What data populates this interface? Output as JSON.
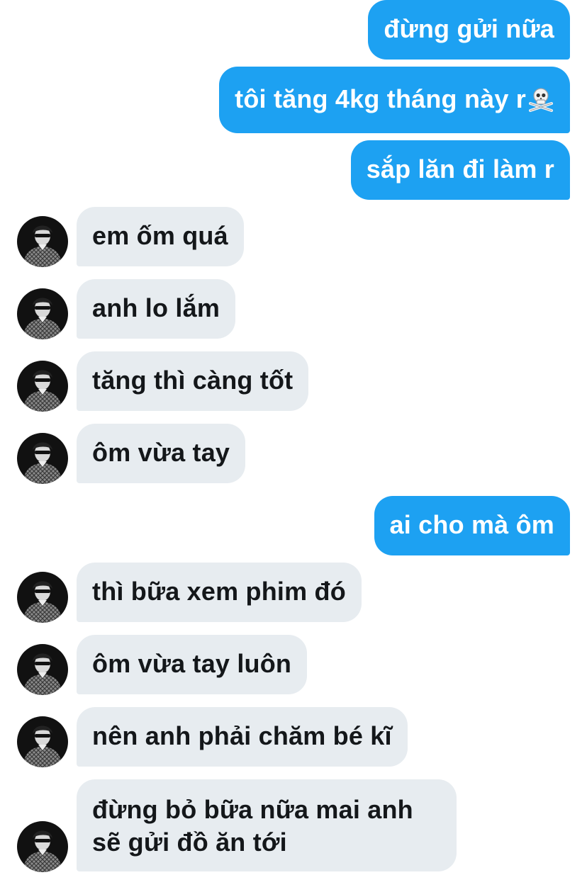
{
  "conversation": {
    "messages": [
      {
        "direction": "outgoing",
        "text": "đừng gửi nữa"
      },
      {
        "direction": "outgoing",
        "text": "tôi tăng 4kg tháng này r",
        "trailing_icon": "skull-crossbones-emoji"
      },
      {
        "direction": "outgoing",
        "text": "sắp lăn đi làm r"
      },
      {
        "direction": "incoming",
        "text": "em ốm quá"
      },
      {
        "direction": "incoming",
        "text": "anh lo lắm"
      },
      {
        "direction": "incoming",
        "text": "tăng thì càng tốt"
      },
      {
        "direction": "incoming",
        "text": "ôm vừa tay"
      },
      {
        "direction": "outgoing",
        "text": "ai cho mà ôm"
      },
      {
        "direction": "incoming",
        "text": "thì bữa xem phim đó"
      },
      {
        "direction": "incoming",
        "text": "ôm vừa tay luôn"
      },
      {
        "direction": "incoming",
        "text": "nên anh phải chăm bé kĩ"
      },
      {
        "direction": "incoming",
        "lines": [
          "đừng bỏ bữa nữa mai anh",
          "sẽ gửi đồ ăn tới"
        ]
      }
    ]
  },
  "theme": {
    "outgoing_bubble_color": "#1da1f2",
    "incoming_bubble_color": "#e7ecf0",
    "incoming_text_color": "#14171a",
    "outgoing_text_color": "#ffffff"
  }
}
